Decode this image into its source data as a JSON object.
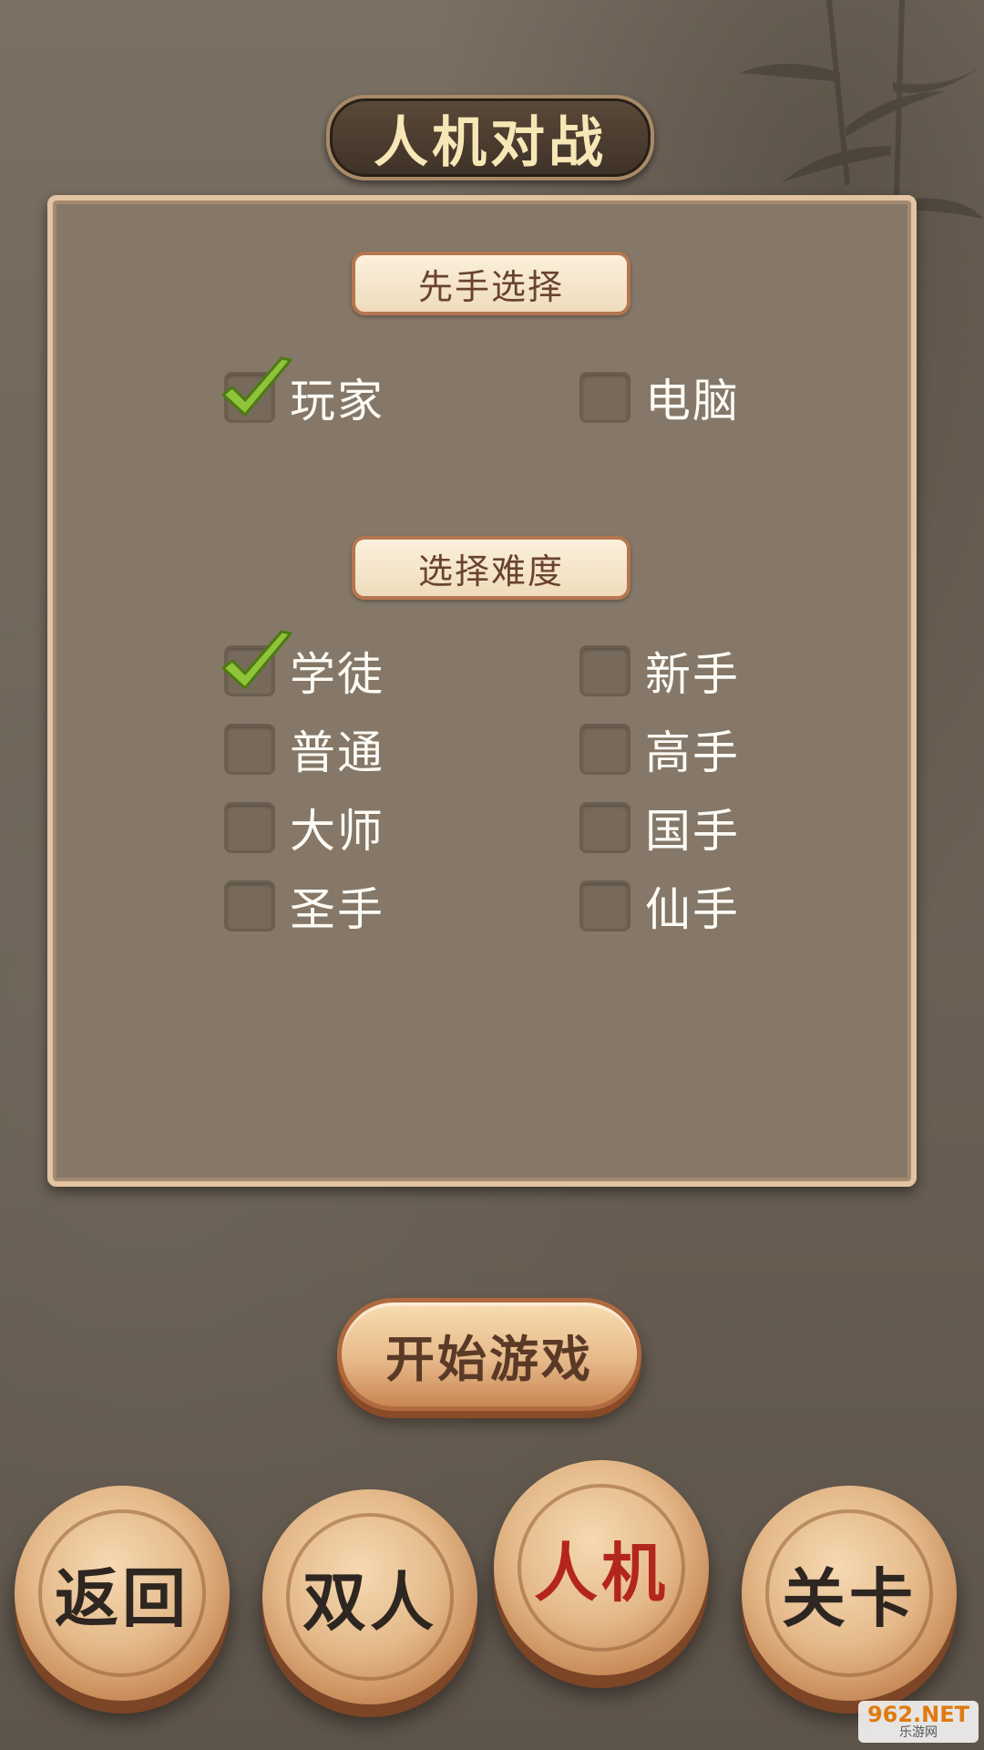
{
  "header": {
    "title": "人机对战"
  },
  "first_move": {
    "label": "先手选择",
    "options": [
      {
        "label": "玩家",
        "checked": true
      },
      {
        "label": "电脑",
        "checked": false
      }
    ]
  },
  "difficulty": {
    "label": "选择难度",
    "options": [
      {
        "label": "学徒",
        "checked": true
      },
      {
        "label": "新手",
        "checked": false
      },
      {
        "label": "普通",
        "checked": false
      },
      {
        "label": "高手",
        "checked": false
      },
      {
        "label": "大师",
        "checked": false
      },
      {
        "label": "国手",
        "checked": false
      },
      {
        "label": "圣手",
        "checked": false
      },
      {
        "label": "仙手",
        "checked": false
      }
    ]
  },
  "start_button": {
    "label": "开始游戏"
  },
  "bottom_nav": {
    "items": [
      {
        "label": "返回",
        "active": false
      },
      {
        "label": "双人",
        "active": false
      },
      {
        "label": "人机",
        "active": true
      },
      {
        "label": "关卡",
        "active": false
      }
    ]
  },
  "watermark": {
    "brand": "962.NET",
    "sub": "乐游网"
  },
  "colors": {
    "active_piece_text": "#b3261e",
    "check_green": "#8fc43a",
    "panel_bg": "#857868"
  }
}
